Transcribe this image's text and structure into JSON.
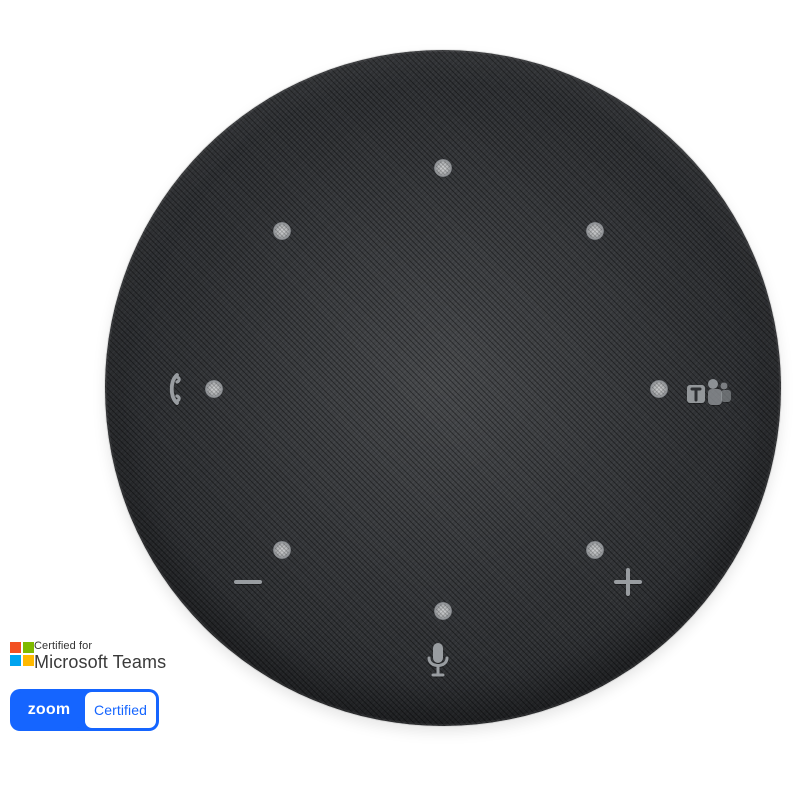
{
  "certifications": {
    "microsoft": {
      "line1": "Certified for",
      "line2": "Microsoft Teams",
      "logo_colors": [
        "#f25022",
        "#7fba00",
        "#00a4ef",
        "#ffb900"
      ]
    },
    "zoom": {
      "left_label": "zoom",
      "right_label": "Certified",
      "brand_color": "#1565ff"
    }
  },
  "device": {
    "body_color": "#2e3033",
    "mic_hole_color": "#b9bbbd",
    "controls": [
      {
        "name": "hook-icon"
      },
      {
        "name": "teams-icon"
      },
      {
        "name": "volume-down-icon"
      },
      {
        "name": "volume-up-icon"
      },
      {
        "name": "microphone-icon"
      }
    ]
  }
}
